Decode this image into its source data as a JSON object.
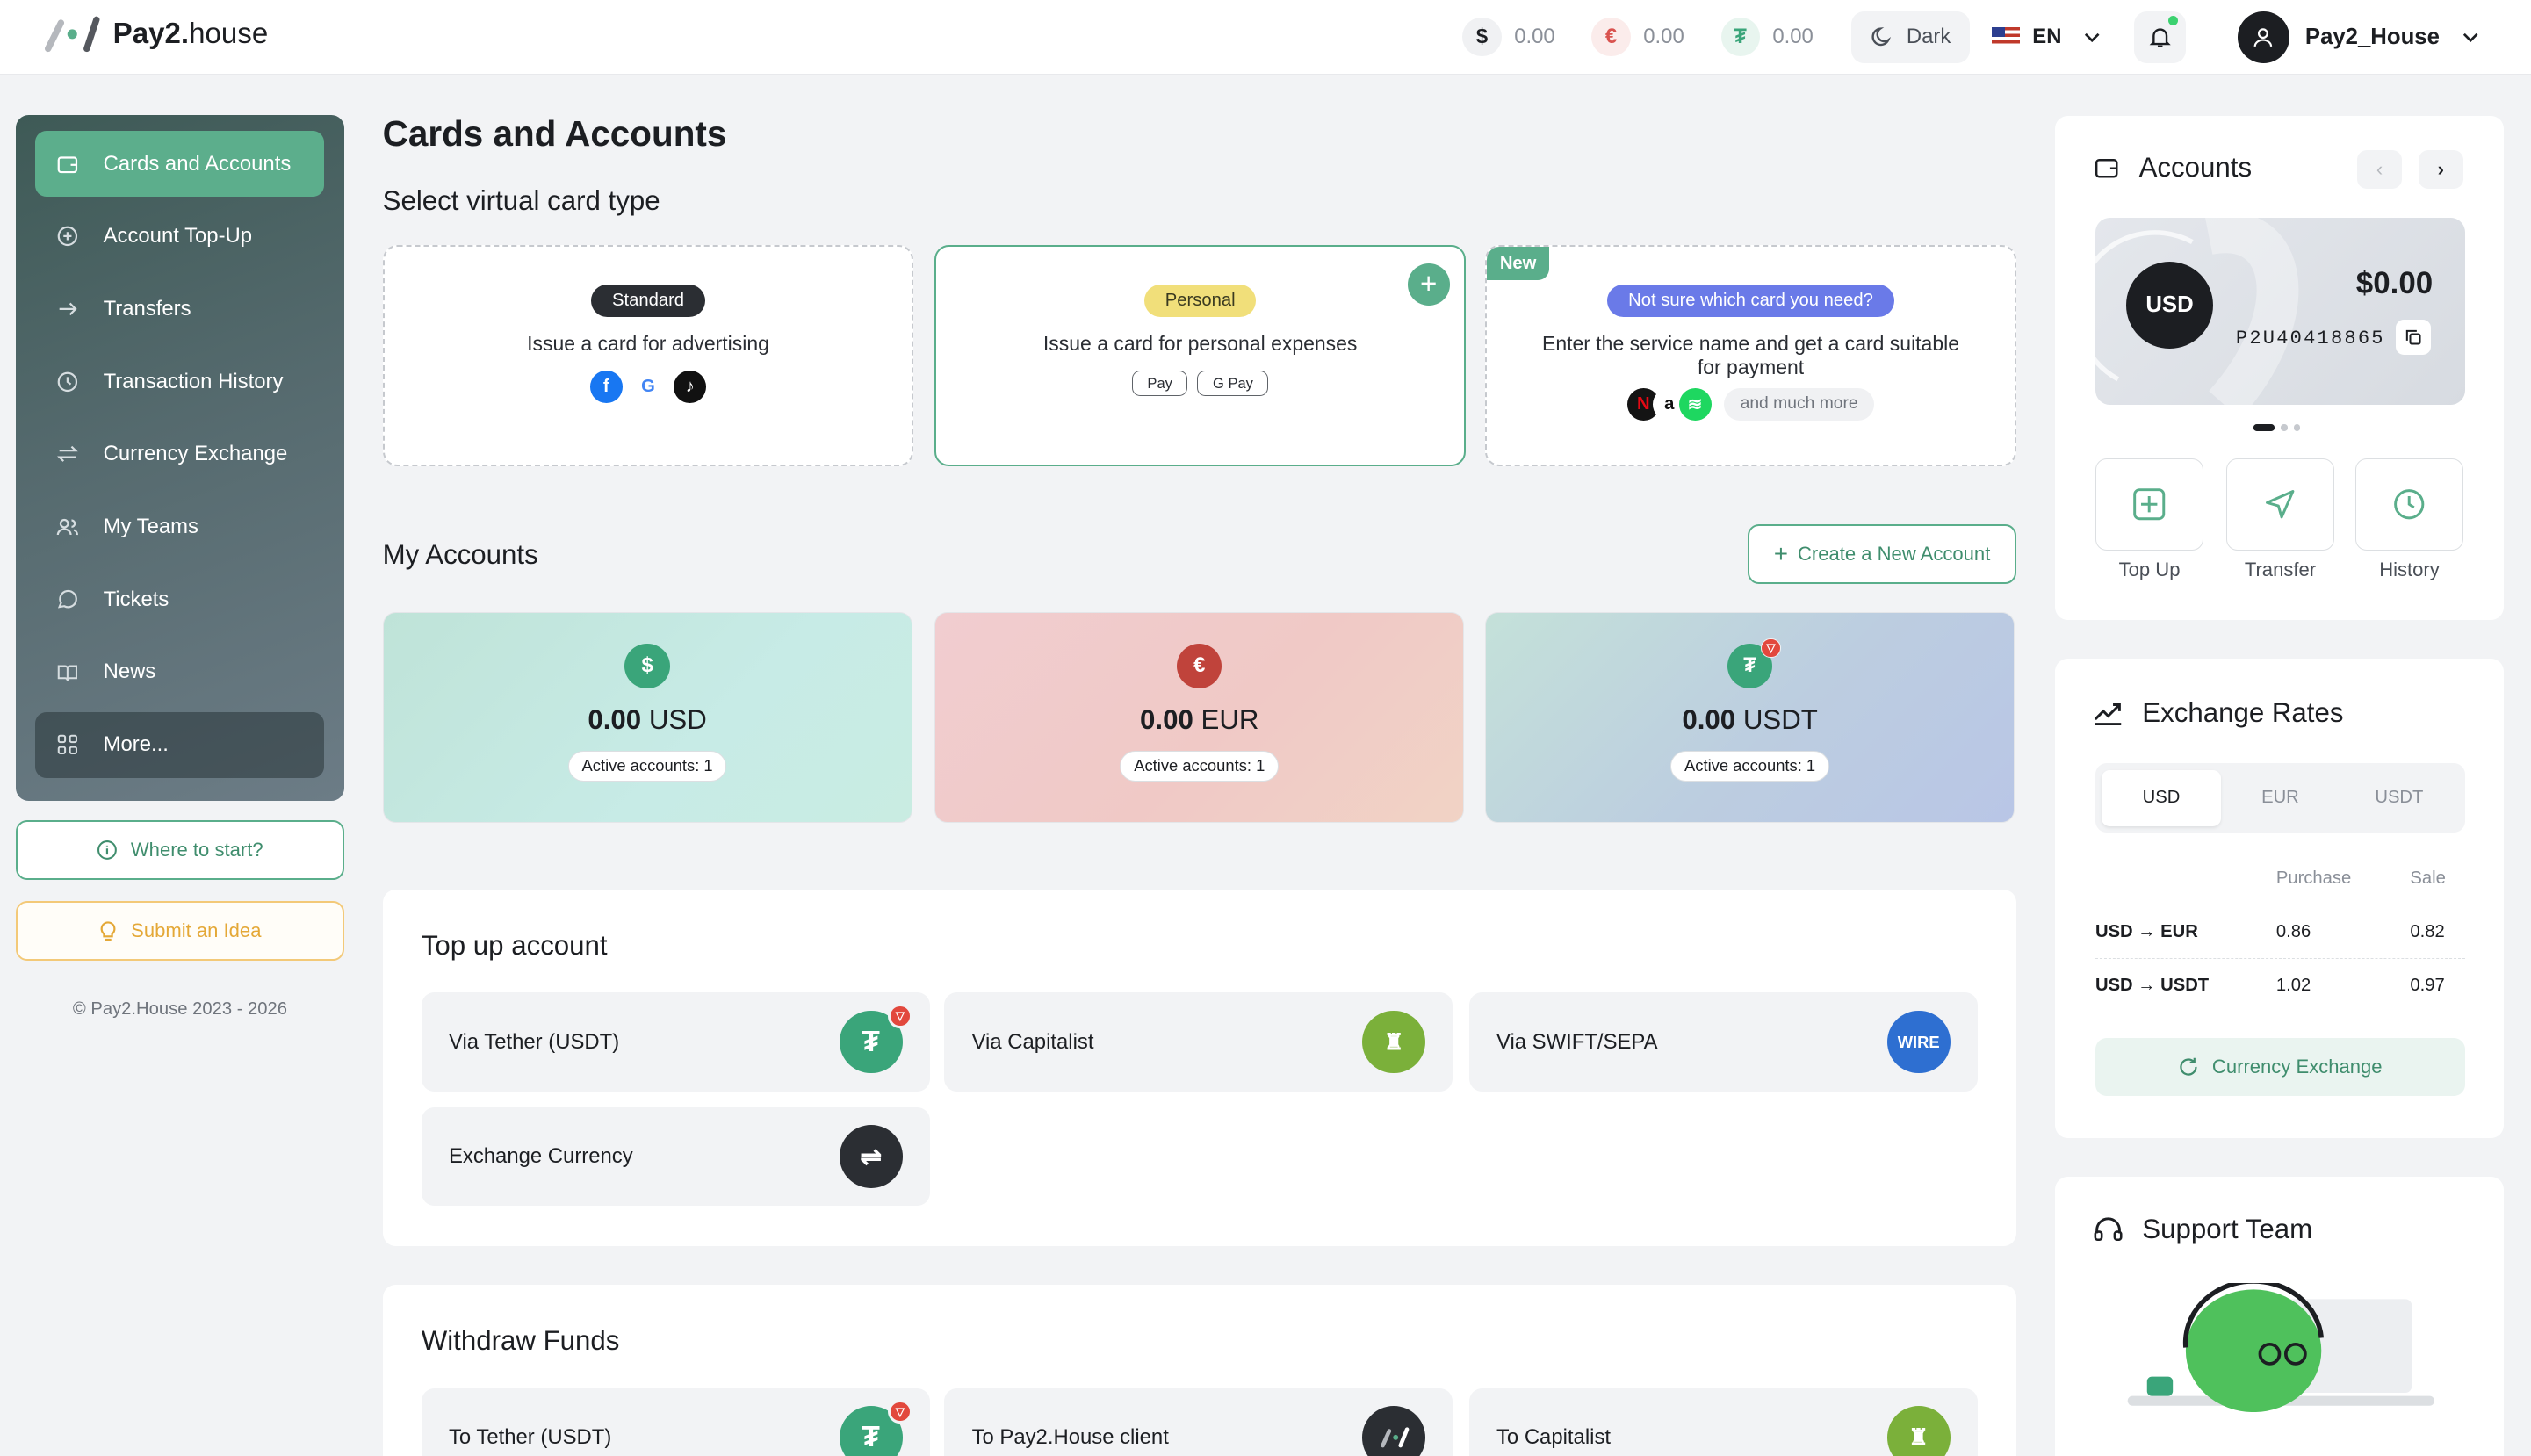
{
  "header": {
    "brand_bold": "Pay2.",
    "brand_light": "house",
    "balances": [
      {
        "symbol": "$",
        "amount": "0.00",
        "color": "#1c1e22",
        "bg": "#f0f1f3"
      },
      {
        "symbol": "€",
        "amount": "0.00",
        "color": "#d9534f",
        "bg": "#fbeceb"
      },
      {
        "symbol": "₮",
        "amount": "0.00",
        "color": "#3aa57a",
        "bg": "#e8f5ef"
      }
    ],
    "theme_label": "Dark",
    "language": "EN",
    "username": "Pay2_House"
  },
  "sidebar": {
    "items": [
      {
        "label": "Cards and Accounts",
        "icon": "wallet-icon"
      },
      {
        "label": "Account Top-Up",
        "icon": "plus-circle-icon"
      },
      {
        "label": "Transfers",
        "icon": "arrow-right-icon"
      },
      {
        "label": "Transaction History",
        "icon": "clock-icon"
      },
      {
        "label": "Currency Exchange",
        "icon": "exchange-icon"
      },
      {
        "label": "My Teams",
        "icon": "users-icon"
      },
      {
        "label": "Tickets",
        "icon": "chat-icon"
      },
      {
        "label": "News",
        "icon": "book-icon"
      },
      {
        "label": "More...",
        "icon": "grid-icon"
      }
    ],
    "where_to_start": "Where to start?",
    "submit_idea": "Submit an Idea",
    "copyright": "© Pay2.House 2023 - 2026"
  },
  "main": {
    "title": "Cards and Accounts",
    "card_type_title": "Select virtual card type",
    "card_types": [
      {
        "badge": "Standard",
        "description": "Issue a card for advertising"
      },
      {
        "badge": "Personal",
        "description": "Issue a card for personal expenses",
        "apple_pay": " Pay",
        "google_pay": "G Pay"
      },
      {
        "tag": "New",
        "badge": "Not sure which card you need?",
        "description": "Enter the service name and get a card suitable for payment",
        "more": "and much more"
      }
    ],
    "my_accounts_title": "My Accounts",
    "create_account_label": "Create a New Account",
    "accounts": [
      {
        "symbol": "$",
        "amount": "0.00",
        "currency": "USD",
        "active": "Active accounts: 1"
      },
      {
        "symbol": "€",
        "amount": "0.00",
        "currency": "EUR",
        "active": "Active accounts: 1"
      },
      {
        "symbol": "₮",
        "amount": "0.00",
        "currency": "USDT",
        "active": "Active accounts: 1"
      }
    ],
    "topup": {
      "title": "Top up account",
      "items": [
        {
          "label": "Via Tether (USDT)"
        },
        {
          "label": "Via Capitalist"
        },
        {
          "label": "Via SWIFT/SEPA",
          "icon_text": "WIRE"
        },
        {
          "label": "Exchange Currency"
        }
      ]
    },
    "withdraw": {
      "title": "Withdraw Funds",
      "items": [
        {
          "label": "To Tether (USDT)"
        },
        {
          "label": "To Pay2.House client"
        },
        {
          "label": "To Capitalist"
        }
      ]
    }
  },
  "right": {
    "accounts_title": "Accounts",
    "card": {
      "currency": "USD",
      "balance": "$0.00",
      "number": "P2U40418865"
    },
    "actions": [
      {
        "label": "Top Up"
      },
      {
        "label": "Transfer"
      },
      {
        "label": "History"
      }
    ],
    "rates_title": "Exchange Rates",
    "rate_tabs": [
      "USD",
      "EUR",
      "USDT"
    ],
    "purchase_header": "Purchase",
    "sale_header": "Sale",
    "rates": [
      {
        "pair": "USD → EUR",
        "purchase": "0.86",
        "sale": "0.82"
      },
      {
        "pair": "USD → USDT",
        "purchase": "1.02",
        "sale": "0.97"
      }
    ],
    "currency_exchange_label": "Currency Exchange",
    "support_title": "Support Team"
  }
}
